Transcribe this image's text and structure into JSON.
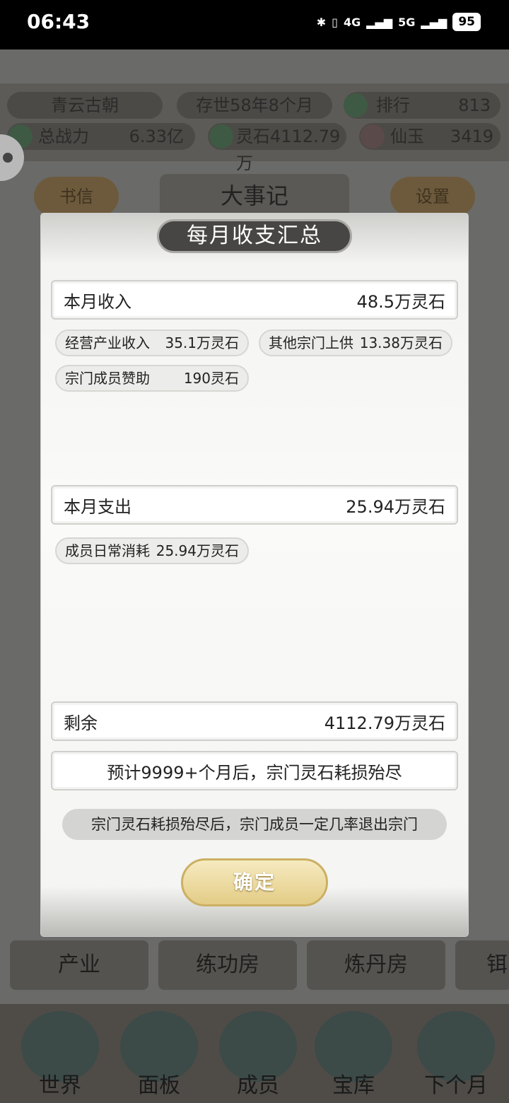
{
  "status_bar": {
    "time": "06:43",
    "network_4g": "4G",
    "network_5g": "5G",
    "battery": "95"
  },
  "game": {
    "sect_name": "青云古朝",
    "age": "存世58年8个月",
    "rank_label": "排行",
    "rank_value": "813",
    "power_label": "总战力",
    "power_value": "6.33亿",
    "spirit_stone": "灵石4112.79万",
    "jade_label": "仙玉",
    "jade_value": "3419",
    "mail_label": "书信",
    "events_title": "大事记",
    "settings_label": "设置",
    "facilities": [
      "产业",
      "练功房",
      "炼丹房",
      "铒"
    ],
    "nav": [
      "世界",
      "面板",
      "成员",
      "宝库",
      "下个月"
    ]
  },
  "dialog": {
    "title": "每月收支汇总",
    "income": {
      "label": "本月收入",
      "value": "48.5万灵石"
    },
    "income_items": [
      {
        "label": "经营产业收入",
        "value": "35.1万灵石"
      },
      {
        "label": "其他宗门上供",
        "value": "13.38万灵石"
      },
      {
        "label": "宗门成员赞助",
        "value": "190灵石"
      }
    ],
    "expense": {
      "label": "本月支出",
      "value": "25.94万灵石"
    },
    "expense_items": [
      {
        "label": "成员日常消耗",
        "value": "25.94万灵石"
      }
    ],
    "remaining": {
      "label": "剩余",
      "value": "4112.79万灵石"
    },
    "forecast": "预计9999+个月后，宗门灵石耗损殆尽",
    "notice": "宗门灵石耗损殆尽后，宗门成员一定几率退出宗门",
    "confirm_label": "确定"
  }
}
